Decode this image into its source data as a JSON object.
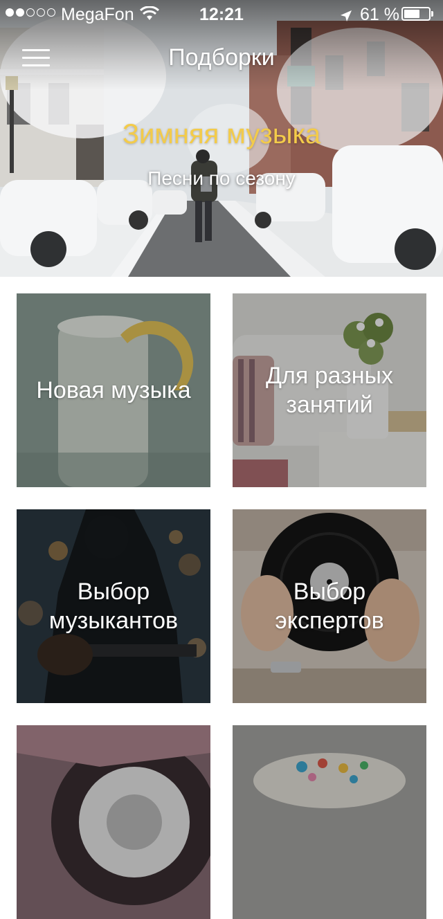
{
  "status_bar": {
    "signal_strength": 2,
    "signal_total": 5,
    "carrier": "MegaFon",
    "wifi_icon": "wifi-icon",
    "time": "12:21",
    "location_icon": "location-arrow-icon",
    "battery_percent": "61 %",
    "battery_level": 0.61
  },
  "nav": {
    "menu_icon": "hamburger-menu-icon",
    "title": "Подборки"
  },
  "hero": {
    "title": "Зимняя музыка",
    "subtitle": "Песни по сезону",
    "title_color": "#f3cb4a"
  },
  "collections": [
    {
      "label": "Новая музыка"
    },
    {
      "label": "Для разных занятий"
    },
    {
      "label": "Выбор музыкантов"
    },
    {
      "label": "Выбор экспертов"
    },
    {
      "label": ""
    },
    {
      "label": ""
    }
  ]
}
